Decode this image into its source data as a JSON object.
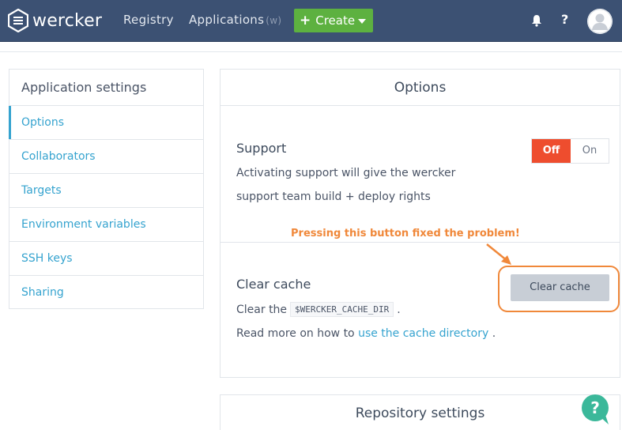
{
  "brand": {
    "name": "wercker"
  },
  "nav": {
    "registry_label": "Registry",
    "applications_label": "Applications",
    "applications_hint": "(w)",
    "create_label": "Create",
    "help_label": "?"
  },
  "sidebar": {
    "title": "Application settings",
    "items": [
      {
        "label": "Options",
        "active": true
      },
      {
        "label": "Collaborators"
      },
      {
        "label": "Targets"
      },
      {
        "label": "Environment variables"
      },
      {
        "label": "SSH keys"
      },
      {
        "label": "Sharing"
      }
    ]
  },
  "options": {
    "title": "Options",
    "support": {
      "heading": "Support",
      "line1": "Activating support will give the wercker",
      "line2": "support team build + deploy rights",
      "toggle_off": "Off",
      "toggle_on": "On",
      "state": "off"
    },
    "cache": {
      "heading": "Clear cache",
      "desc_prefix": "Clear the",
      "desc_code": "$WERCKER_CACHE_DIR",
      "desc_suffix": ".",
      "read_prefix": "Read more on how to",
      "read_link": "use the cache directory",
      "read_suffix": ".",
      "button_label": "Clear cache"
    }
  },
  "annotation": {
    "text": "Pressing this button fixed the problem!",
    "color": "#f0883a"
  },
  "repository": {
    "title": "Repository settings"
  },
  "colors": {
    "topbar": "#3c5173",
    "create": "#5db140",
    "link": "#35a3cf",
    "toggle_off": "#ee4d2e",
    "help_bubble": "#3bb89a"
  }
}
